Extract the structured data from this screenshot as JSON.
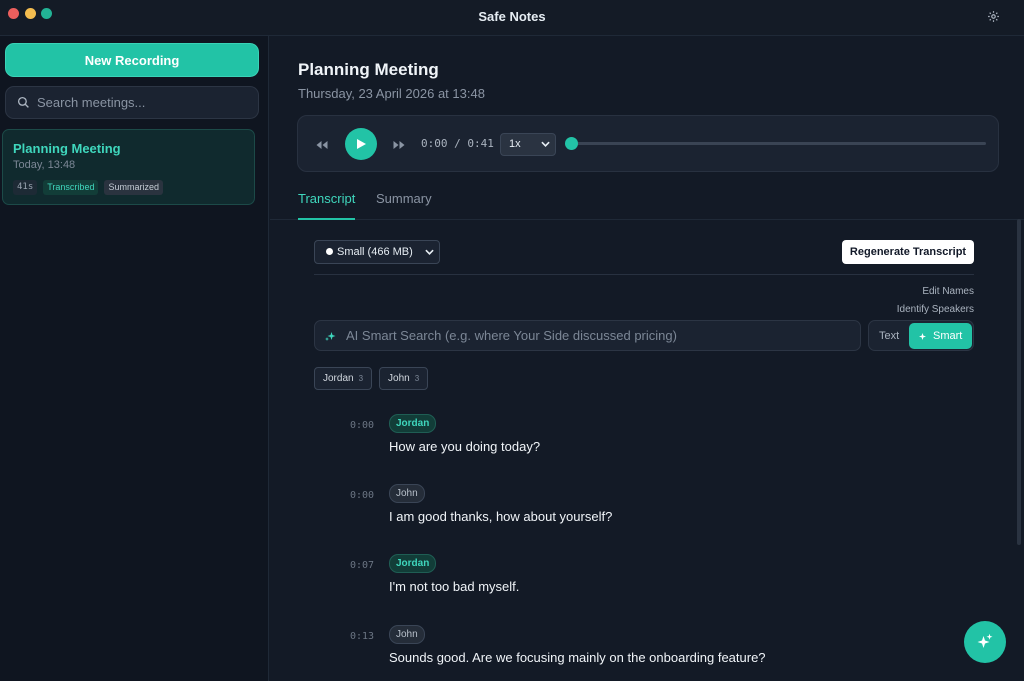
{
  "window": {
    "title": "Safe Notes"
  },
  "sidebar": {
    "new_recording_label": "New Recording",
    "search_placeholder": "Search meetings...",
    "meetings": [
      {
        "title": "Planning Meeting",
        "subtitle": "Today, 13:48",
        "duration": "41s",
        "tags": [
          "Transcribed",
          "Summarized"
        ]
      }
    ]
  },
  "main": {
    "title": "Planning Meeting",
    "date": "Thursday, 23 April 2026 at 13:48",
    "player": {
      "time": "0:00 / 0:41",
      "speed": "1x",
      "progress": 0
    },
    "tabs": [
      "Transcript",
      "Summary"
    ],
    "active_tab": "Transcript",
    "transcript": {
      "model_label": "Small (466 MB)",
      "regenerate_label": "Regenerate Transcript",
      "edit_names_label": "Edit Names",
      "identify_speakers_label": "Identify Speakers",
      "ai_search_placeholder": "AI Smart Search (e.g. where Your Side discussed pricing)",
      "mode_text_label": "Text",
      "mode_smart_label": "Smart",
      "speakers": [
        {
          "name": "Jordan",
          "count": "3"
        },
        {
          "name": "John",
          "count": "3"
        }
      ],
      "entries": [
        {
          "time": "0:00",
          "speaker": "Jordan",
          "text": "How are you doing today?"
        },
        {
          "time": "0:00",
          "speaker": "John",
          "text": "I am good thanks, how about yourself?"
        },
        {
          "time": "0:07",
          "speaker": "Jordan",
          "text": "I'm not too bad myself."
        },
        {
          "time": "0:13",
          "speaker": "John",
          "text": "Sounds good. Are we focusing mainly on the onboarding feature?"
        }
      ]
    }
  },
  "colors": {
    "accent": "#22c3a6",
    "background": "#131a26",
    "sidebar": "#0f1520"
  }
}
